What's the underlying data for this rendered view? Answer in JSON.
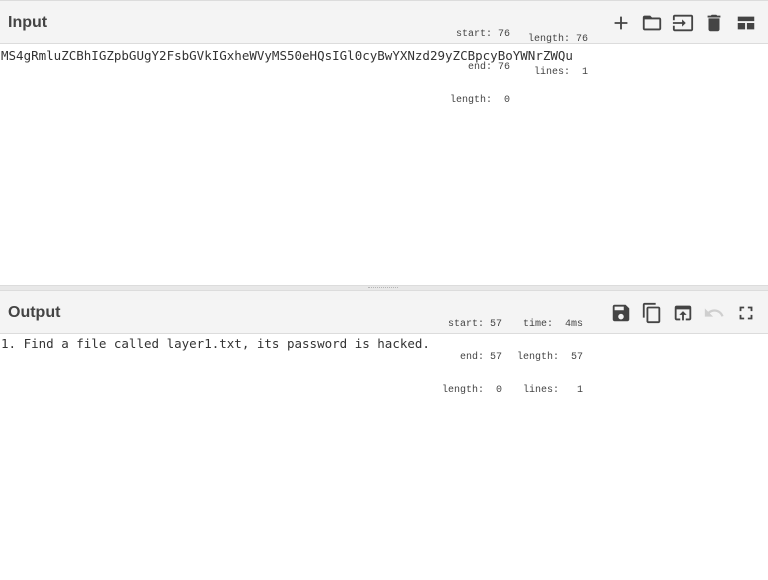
{
  "input": {
    "title": "Input",
    "text": "MS4gRmluZCBhIGZpbGUgY2FsbGVkIGxheWVyMS50eHQsIGl0cyBwYXNzd29yZCBpcyBoYWNrZWQu",
    "stats_left": [
      "start: 76",
      "end: 76",
      "length:  0"
    ],
    "stats_right": [
      "length: 76",
      "lines:  1"
    ],
    "icons": [
      "add-input-icon",
      "open-file-icon",
      "replace-input-icon",
      "delete-icon",
      "layout-icon"
    ]
  },
  "output": {
    "title": "Output",
    "text": "1. Find a file called layer1.txt, its password is hacked.",
    "stats_left": [
      "start: 57",
      "end: 57",
      "length:  0"
    ],
    "stats_right": [
      "time:  4ms",
      "length:  57",
      "lines:   1"
    ],
    "icons": [
      "save-icon",
      "copy-icon",
      "move-to-input-icon",
      "undo-icon",
      "maximize-icon"
    ]
  }
}
